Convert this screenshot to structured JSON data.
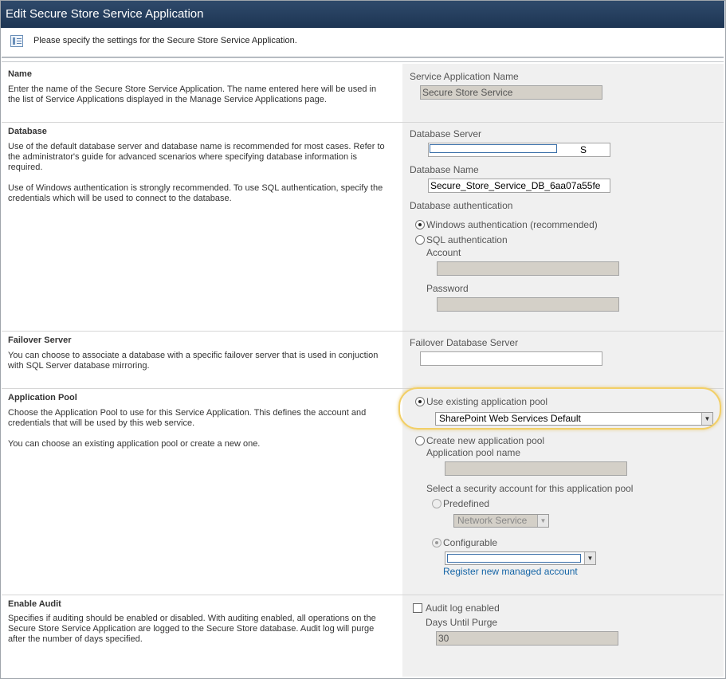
{
  "window": {
    "title": "Edit Secure Store Service Application"
  },
  "intro": {
    "text": "Please specify the settings for the Secure Store Service Application."
  },
  "sections": {
    "name": {
      "title": "Name",
      "desc": "Enter the name of the Secure Store Service Application. The name entered here will be used in the list of Service Applications displayed in the Manage Service Applications page.",
      "field_label": "Service Application Name",
      "field_value": "Secure Store Service"
    },
    "database": {
      "title": "Database",
      "desc1": "Use of the default database server and database name is recommended for most cases. Refer to the administrator's guide for advanced scenarios where specifying database information is required.",
      "desc2": "Use of Windows authentication is strongly recommended. To use SQL authentication, specify the credentials which will be used to connect to the database.",
      "server_label": "Database Server",
      "server_value_tail": "S",
      "name_label": "Database Name",
      "name_value": "Secure_Store_Service_DB_6aa07a55fe",
      "auth_label": "Database authentication",
      "auth_windows": "Windows authentication (recommended)",
      "auth_sql": "SQL authentication",
      "account_label": "Account",
      "password_label": "Password"
    },
    "failover": {
      "title": "Failover Server",
      "desc": "You can choose to associate a database with a specific failover server that is used in conjuction with SQL Server database mirroring.",
      "field_label": "Failover Database Server"
    },
    "app_pool": {
      "title": "Application Pool",
      "desc1": "Choose the Application Pool to use for this Service Application.  This defines the account and credentials that will be used by this web service.",
      "desc2": "You can choose an existing application pool or create a new one.",
      "use_existing": "Use existing application pool",
      "existing_value": "SharePoint Web Services Default",
      "create_new": "Create new application pool",
      "pool_name_label": "Application pool name",
      "security_label": "Select a security account for this application pool",
      "predefined": "Predefined",
      "predefined_value": "Network Service",
      "configurable": "Configurable",
      "register_link": "Register new managed account"
    },
    "audit": {
      "title": "Enable Audit",
      "desc": "Specifies if auditing should be enabled or disabled. With auditing enabled, all operations on the Secure Store Service Application are logged to the Secure Store database. Audit log will purge after the number of days specified.",
      "checkbox_label": "Audit log enabled",
      "days_label": "Days Until Purge",
      "days_value": "30"
    }
  }
}
